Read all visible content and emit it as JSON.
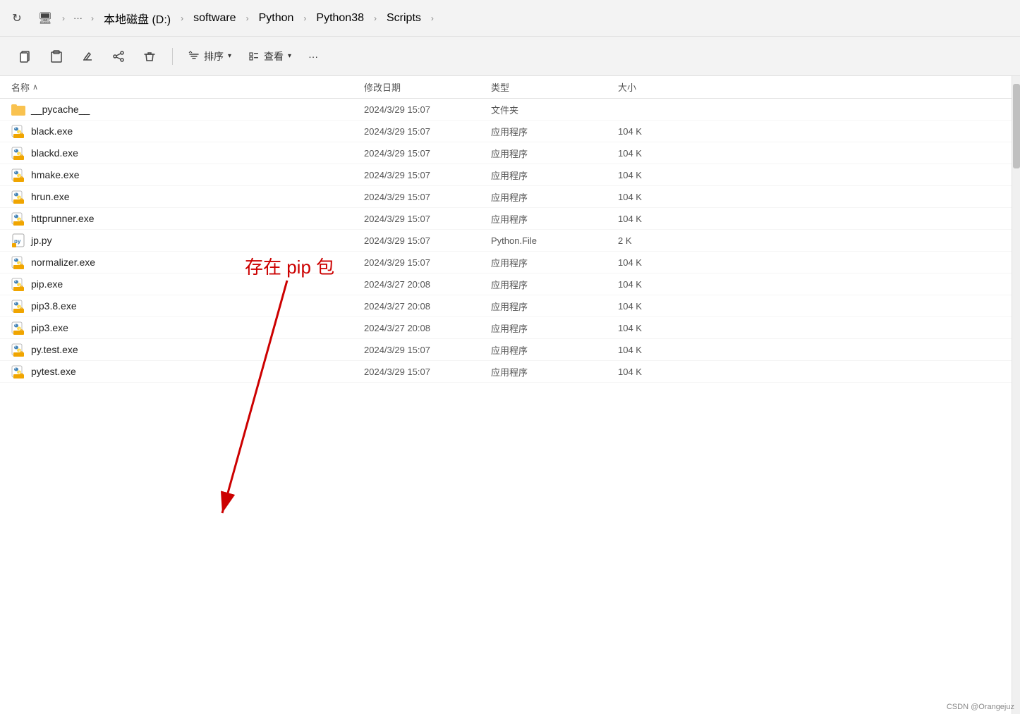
{
  "titlebar": {
    "refresh_title": "刷新",
    "breadcrumb": [
      {
        "label": "⬜",
        "id": "computer"
      },
      {
        "label": "本地磁盘 (D:)",
        "id": "disk-d"
      },
      {
        "label": "software",
        "id": "software"
      },
      {
        "label": "Python",
        "id": "python"
      },
      {
        "label": "Python38",
        "id": "python38"
      },
      {
        "label": "Scripts",
        "id": "scripts"
      }
    ]
  },
  "toolbar": {
    "sort_label": "排序",
    "view_label": "查看",
    "more_label": "···"
  },
  "columns": {
    "name": "名称",
    "date": "修改日期",
    "type": "类型",
    "size": "大小"
  },
  "annotation": {
    "text": "存在 pip 包"
  },
  "files": [
    {
      "name": "__pycache__",
      "date": "2024/3/29 15:07",
      "type": "文件夹",
      "size": "",
      "icon": "folder"
    },
    {
      "name": "black.exe",
      "date": "2024/3/29 15:07",
      "type": "应用程序",
      "size": "104 K",
      "icon": "exe"
    },
    {
      "name": "blackd.exe",
      "date": "2024/3/29 15:07",
      "type": "应用程序",
      "size": "104 K",
      "icon": "exe"
    },
    {
      "name": "hmake.exe",
      "date": "2024/3/29 15:07",
      "type": "应用程序",
      "size": "104 K",
      "icon": "exe"
    },
    {
      "name": "hrun.exe",
      "date": "2024/3/29 15:07",
      "type": "应用程序",
      "size": "104 K",
      "icon": "exe"
    },
    {
      "name": "httprunner.exe",
      "date": "2024/3/29 15:07",
      "type": "应用程序",
      "size": "104 K",
      "icon": "exe"
    },
    {
      "name": "jp.py",
      "date": "2024/3/29 15:07",
      "type": "Python.File",
      "size": "2 K",
      "icon": "py"
    },
    {
      "name": "normalizer.exe",
      "date": "2024/3/29 15:07",
      "type": "应用程序",
      "size": "104 K",
      "icon": "exe"
    },
    {
      "name": "pip.exe",
      "date": "2024/3/27 20:08",
      "type": "应用程序",
      "size": "104 K",
      "icon": "exe"
    },
    {
      "name": "pip3.8.exe",
      "date": "2024/3/27 20:08",
      "type": "应用程序",
      "size": "104 K",
      "icon": "exe"
    },
    {
      "name": "pip3.exe",
      "date": "2024/3/27 20:08",
      "type": "应用程序",
      "size": "104 K",
      "icon": "exe"
    },
    {
      "name": "py.test.exe",
      "date": "2024/3/29 15:07",
      "type": "应用程序",
      "size": "104 K",
      "icon": "exe"
    },
    {
      "name": "pytest.exe",
      "date": "2024/3/29 15:07",
      "type": "应用程序",
      "size": "104 K",
      "icon": "exe"
    }
  ],
  "watermark": "CSDN @Orangejuz"
}
